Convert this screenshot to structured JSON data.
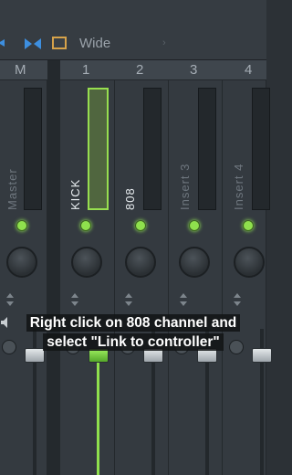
{
  "toolbar": {
    "view_label": "Wide",
    "chevron": "›"
  },
  "channels": [
    {
      "number": "M",
      "name": "Master",
      "name_color": "#6e767e",
      "active": false
    },
    {
      "number": "1",
      "name": "KICK",
      "name_color": "#e6ebee",
      "active": true
    },
    {
      "number": "2",
      "name": "808",
      "name_color": "#e6ebee",
      "active": false
    },
    {
      "number": "3",
      "name": "Insert 3",
      "name_color": "#6e767e",
      "active": false
    },
    {
      "number": "4",
      "name": "Insert 4",
      "name_color": "#6e767e",
      "active": false
    }
  ],
  "caption": {
    "line1": "Right click on 808 channel and",
    "line2": "select \"Link to controller\""
  },
  "colors": {
    "accent_green": "#8fe04d",
    "orange": "#d6a24a",
    "blue": "#3d8fe0"
  }
}
